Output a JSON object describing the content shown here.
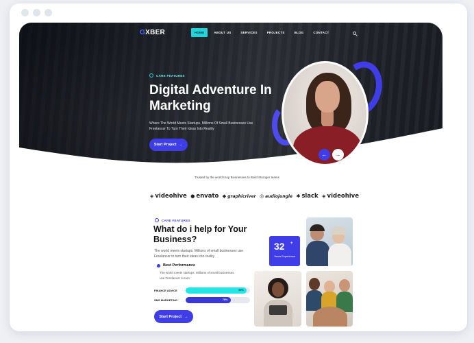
{
  "nav": {
    "logo_text": "XBER",
    "logo_glyph": "G",
    "menu": [
      "HOME",
      "ABOUT US",
      "SERVICES",
      "PROJECTS",
      "BLOG",
      "CONTACT"
    ],
    "active_index": 0
  },
  "hero": {
    "badge": "CARE FEATURES",
    "title": "Digital Adventure In Marketing",
    "subtitle": "Where The World Meets Startups. Millions Of Small Businesses Use Freelancer To Turn Their Ideas Into Reality",
    "button": "Start Project",
    "button_arrow": "→",
    "prev_arrow": "←",
    "next_arrow": "→"
  },
  "trusted": {
    "text": "Trusted by the world's top Businesses to Build Stronger teams",
    "brands": [
      {
        "name": "videohive",
        "mark": "◈"
      },
      {
        "name": "envato",
        "mark": "●"
      },
      {
        "name": "graphicriver",
        "mark": "◆"
      },
      {
        "name": "audiojungle",
        "mark": "◎"
      },
      {
        "name": "slack",
        "mark": "✱"
      },
      {
        "name": "videohive",
        "mark": "◈"
      }
    ]
  },
  "section": {
    "badge": "CARE FEATURES",
    "title": "What do i help for Your Business?",
    "text": "The world meets startups. Millions of small businesses use Freelancer to turn their ideas into reality",
    "feature_title": "Best Performance",
    "feature_text": "The world meets startups. Millions of small businesses use Freelancer to turn",
    "bars": [
      {
        "label": "FINANCE ADVICE",
        "value": "95%",
        "percent": 95
      },
      {
        "label": "SMS MARKETING",
        "value": "70%",
        "percent": 70
      }
    ],
    "button": "Start Project",
    "button_arrow": "→",
    "experience": {
      "number": "32",
      "plus": "+",
      "label": "Years Experience"
    }
  },
  "colors": {
    "accent": "#3f3de8",
    "cyan": "#21d4d9",
    "dark": "#111111"
  }
}
